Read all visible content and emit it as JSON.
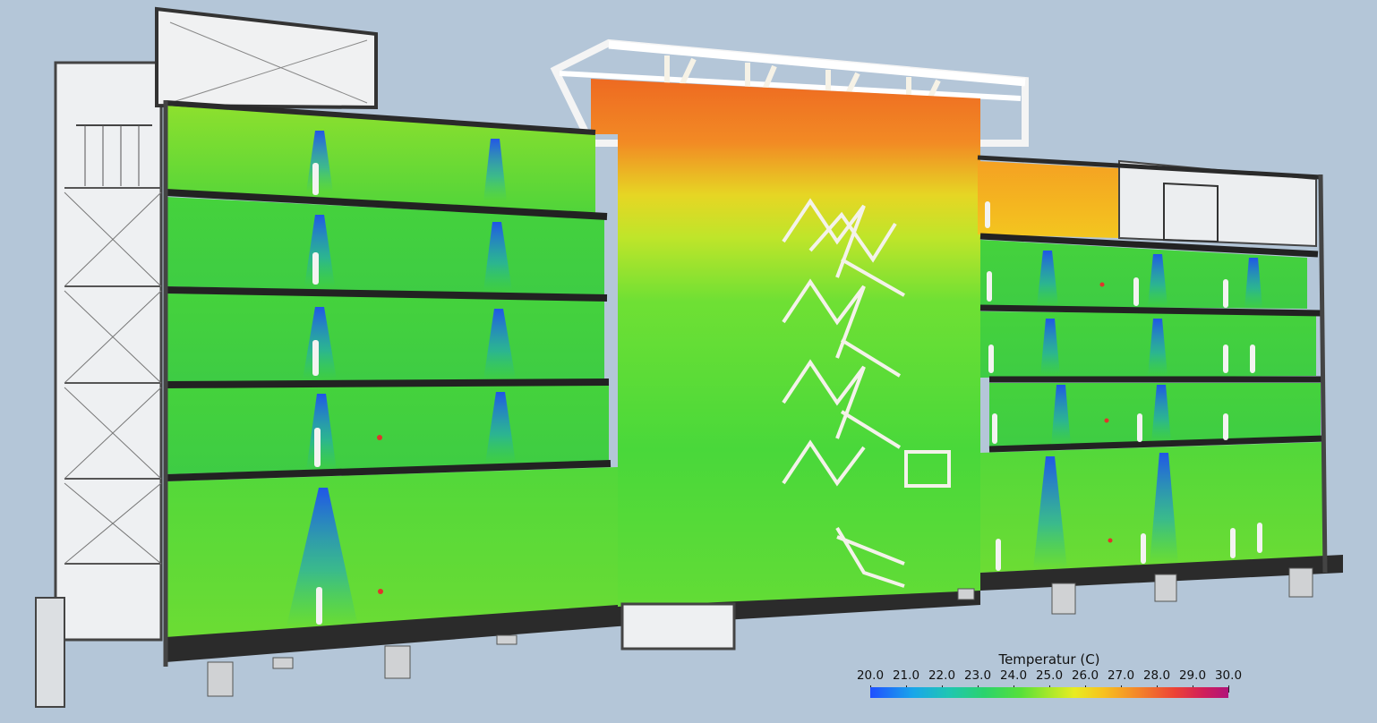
{
  "legend": {
    "title": "Temperatur (C)",
    "ticks": [
      "20.0",
      "21.0",
      "22.0",
      "23.0",
      "24.0",
      "25.0",
      "26.0",
      "27.0",
      "28.0",
      "29.0",
      "30.0"
    ]
  },
  "colors": {
    "background": "#b4c6d8",
    "cool": "#2a7fe0",
    "neutral": "#5fe03c",
    "warm": "#f08a2a",
    "hot": "#e0342c"
  },
  "icons": [
    "person-figure-icon",
    "ceiling-diffuser-icon",
    "staircase-icon",
    "roof-truss-icon"
  ]
}
